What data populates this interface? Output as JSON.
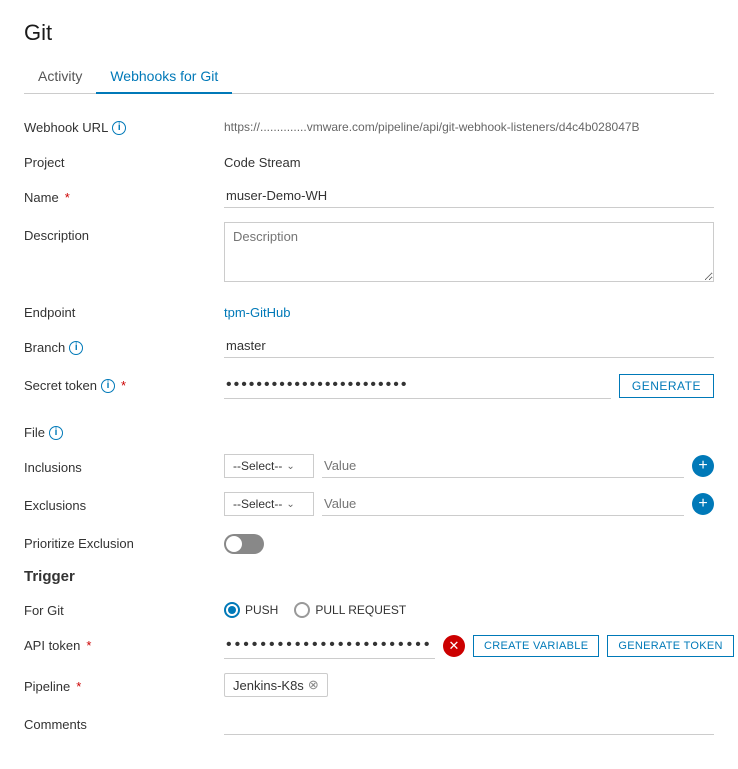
{
  "page": {
    "title": "Git"
  },
  "tabs": [
    {
      "id": "activity",
      "label": "Activity",
      "active": false
    },
    {
      "id": "webhooks",
      "label": "Webhooks for Git",
      "active": true
    }
  ],
  "form": {
    "webhook_url_label": "Webhook URL",
    "webhook_url_value": "https://..............vmware.com/pipeline/api/git-webhook-listeners/d4c4b028047B",
    "project_label": "Project",
    "project_value": "Code Stream",
    "name_label": "Name",
    "name_required": "*",
    "name_value": "muser-Demo-WH",
    "description_label": "Description",
    "description_placeholder": "Description",
    "endpoint_label": "Endpoint",
    "endpoint_value": "tpm-GitHub",
    "branch_label": "Branch",
    "branch_value": "master",
    "secret_token_label": "Secret token",
    "secret_token_required": "*",
    "secret_token_value": "••••••••••••••••••••••••",
    "generate_button": "GENERATE",
    "file_label": "File",
    "inclusions_label": "Inclusions",
    "exclusions_label": "Exclusions",
    "select_placeholder": "--Select--",
    "value_placeholder": "Value",
    "prioritize_label": "Prioritize Exclusion",
    "trigger_title": "Trigger",
    "for_git_label": "For Git",
    "push_label": "PUSH",
    "pull_request_label": "PULL REQUEST",
    "api_token_label": "API token",
    "api_token_required": "*",
    "api_token_value": "••••••••••••••••••••••••••••••",
    "create_variable_button": "CREATE VARIABLE",
    "generate_token_button": "GENERATE TOKEN",
    "pipeline_label": "Pipeline",
    "pipeline_required": "*",
    "pipeline_value": "Jenkins-K8s",
    "comments_label": "Comments"
  },
  "icons": {
    "info": "i",
    "add": "+",
    "close": "✕",
    "chevron": "⌄"
  }
}
